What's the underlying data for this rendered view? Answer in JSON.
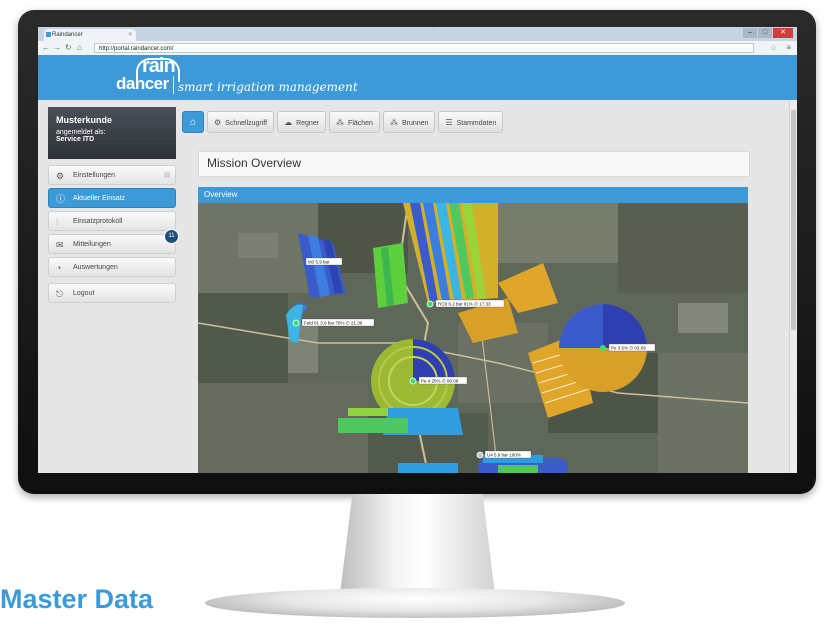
{
  "browser": {
    "tab_title": "Raindancer",
    "tab_close": "×",
    "url": "http://portal.raindancer.com/",
    "minimize": "–",
    "maximize": "□",
    "close": "✕"
  },
  "app": {
    "logo_top": "rain",
    "logo_bottom": "dancer",
    "tagline": "smart irrigation management"
  },
  "user": {
    "name": "Musterkunde",
    "logged_in_label": "angemeldet als:",
    "role": "Service ITD"
  },
  "sidebar": {
    "items": [
      {
        "label": "Einstellungen",
        "icon": "gear-icon",
        "active": false
      },
      {
        "label": "Aktueller Einsatz",
        "icon": "info-icon",
        "active": true
      },
      {
        "label": "Einsatzprotokoll",
        "icon": "sliders-icon",
        "active": false
      },
      {
        "label": "Mitteilungen",
        "icon": "mail-icon",
        "active": false,
        "badge": "11"
      },
      {
        "label": "Auswertungen",
        "icon": "pie-chart-icon",
        "active": false
      },
      {
        "label": "Logout",
        "icon": "logout-icon",
        "active": false
      }
    ]
  },
  "toolbar": {
    "items": [
      {
        "label": "Schnellzugriff",
        "icon": "gear-icon"
      },
      {
        "label": "Regner",
        "icon": "sprinkler-icon"
      },
      {
        "label": "Flächen",
        "icon": "grid-icon"
      },
      {
        "label": "Brunnen",
        "icon": "grid-icon"
      },
      {
        "label": "Stammdaten",
        "icon": "list-icon"
      }
    ]
  },
  "main": {
    "title": "Mission Overview",
    "panel_title": "Overview"
  },
  "map": {
    "labels": [
      "M3 5.9 bar",
      "RO3 6.2 bar 91% ∅ 17.33",
      "Feld 01 3.9 bar 76% ∅ 21.30",
      "Pe 4 25% ∅ 08.06",
      "Pe 3 5% ∅ 03.09",
      "U4 5.9 bar 100%"
    ]
  },
  "footer": {
    "heading": "Master Data"
  },
  "colors": {
    "brand": "#3c9ad9",
    "heading": "#3c9ad9"
  }
}
